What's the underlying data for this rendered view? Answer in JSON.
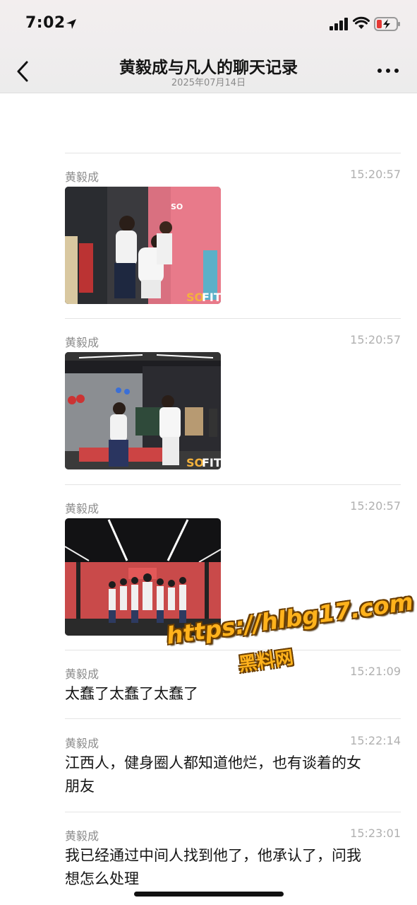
{
  "status_bar": {
    "time": "7:02"
  },
  "nav": {
    "title": "黄毅成与凡人的聊天记录",
    "subtitle": "2025年07月14日"
  },
  "messages": [
    {
      "sender": "黄毅成",
      "time": "15:20:57",
      "type": "image"
    },
    {
      "sender": "黄毅成",
      "time": "15:20:57",
      "type": "image"
    },
    {
      "sender": "黄毅成",
      "time": "15:20:57",
      "type": "image"
    },
    {
      "sender": "黄毅成",
      "time": "15:21:09",
      "type": "text",
      "text": "太蠢了太蠢了太蠢了"
    },
    {
      "sender": "黄毅成",
      "time": "15:22:14",
      "type": "text",
      "text_line1": "江西人，健身圈人都知道他烂，也有谈着的女",
      "text_line2": "朋友"
    },
    {
      "sender": "黄毅成",
      "time": "15:23:01",
      "type": "text",
      "text_line1": "我已经通过中间人找到他了，他承认了，问我",
      "text_line2": "想怎么处理"
    }
  ],
  "photo_brand": {
    "so": "SO",
    "fit": "FIT"
  },
  "watermark": {
    "url": "https://hlbg17.com",
    "name": "黑料网"
  },
  "colors": {
    "brand_orange": "#ffb21c",
    "wall_pink": "#e87a8a",
    "gym_red": "#c43a3a"
  }
}
